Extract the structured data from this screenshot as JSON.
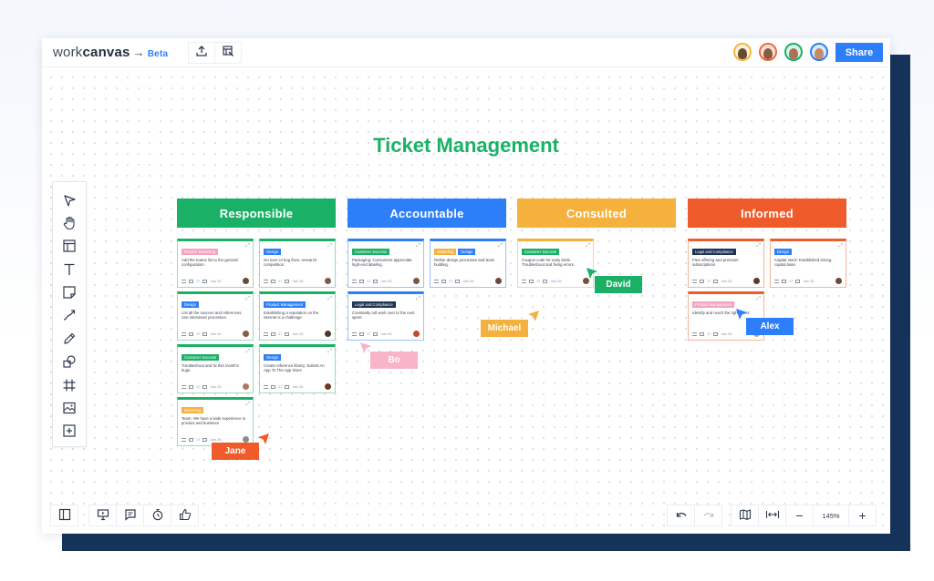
{
  "app": {
    "logo_light": "work",
    "logo_bold": "canvas",
    "logo_arrow": "→",
    "beta_label": "Beta",
    "share_label": "Share",
    "topbar_icons": [
      "upload-icon",
      "board-select-icon"
    ],
    "collaborators": [
      {
        "name": "collaborator-1",
        "ring": "#f5b83d",
        "skin": "#6b4a34"
      },
      {
        "name": "collaborator-2",
        "ring": "#ef6a3a",
        "skin": "#8a5a44"
      },
      {
        "name": "collaborator-3",
        "ring": "#1ab166",
        "skin": "#a87458"
      },
      {
        "name": "collaborator-4",
        "ring": "#2d7ff9",
        "skin": "#c48b68"
      }
    ]
  },
  "board": {
    "title": "Ticket Management",
    "columns": [
      {
        "label": "Responsible",
        "color": "#1ab166"
      },
      {
        "label": "Accountable",
        "color": "#2d7ff9"
      },
      {
        "label": "Consulted",
        "color": "#f5b13d"
      },
      {
        "label": "Informed",
        "color": "#ef5b2b"
      }
    ],
    "tag_colors": {
      "Product Marketing": "#f6a3bd",
      "Design": "#2d7ff9",
      "Product Management": "#2d7ff9",
      "Customer Success": "#1ab166",
      "Marketing": "#f5b13d",
      "Legal and Compliance": "#1f3354",
      "Product Management Pink": "#f6a3bd"
    },
    "cards": [
      {
        "col": 0,
        "tags": [
          {
            "text": "Product Marketing",
            "color": "#f6a3bd"
          }
        ],
        "desc": "Add the teams list to the general configuration.",
        "comments": "17",
        "date": "Jan 25"
      },
      {
        "col": 0,
        "tags": [
          {
            "text": "Design",
            "color": "#2d7ff9"
          }
        ],
        "desc": "Go over UI bug fixes, research competition.",
        "comments": "17",
        "date": "Jan 25"
      },
      {
        "col": 0,
        "tags": [
          {
            "text": "Design",
            "color": "#2d7ff9"
          }
        ],
        "desc": "List all the sources and references. Use interviews processes.",
        "comments": "17",
        "date": "Jan 25"
      },
      {
        "col": 0,
        "tags": [
          {
            "text": "Product Management",
            "color": "#2d7ff9"
          }
        ],
        "desc": "Establishing a reputation on the internet is a challenge",
        "comments": "17",
        "date": "Jan 25"
      },
      {
        "col": 0,
        "tags": [
          {
            "text": "Customer Success",
            "color": "#1ab166"
          }
        ],
        "desc": "Troubleshoot and fix this month's bugs.",
        "comments": "17",
        "date": "Jan 25"
      },
      {
        "col": 0,
        "tags": [
          {
            "text": "Design",
            "color": "#2d7ff9"
          }
        ],
        "desc": "Create reference library. Submit An App To The App Store",
        "comments": "17",
        "date": "Jan 25"
      },
      {
        "col": 0,
        "tags": [
          {
            "text": "Marketing",
            "color": "#f5b13d"
          }
        ],
        "desc": "Team: We have a wide experience in product and business",
        "comments": "17",
        "date": "Jan 25"
      },
      {
        "col": 1,
        "tags": [
          {
            "text": "Customer Success",
            "color": "#1ab166"
          }
        ],
        "desc": "Packaging: Consumers appreciate high-end labeling",
        "comments": "17",
        "date": "Jan 25"
      },
      {
        "col": 1,
        "tags": [
          {
            "text": "Marketing",
            "color": "#f5b13d"
          },
          {
            "text": "Design",
            "color": "#2d7ff9"
          }
        ],
        "desc": "Refine design processes and team building.",
        "comments": "17",
        "date": "Jan 25"
      },
      {
        "col": 1,
        "tags": [
          {
            "text": "Legal and Compliance",
            "color": "#1f3354"
          }
        ],
        "desc": "Constantly roll work over to the next sprint",
        "comments": "17",
        "date": "Jan 25"
      },
      {
        "col": 2,
        "tags": [
          {
            "text": "Customer Success",
            "color": "#1ab166"
          }
        ],
        "desc": "Coupon code for early birds. Troubleshoot and fixing errors.",
        "comments": "17",
        "date": "Jan 25"
      },
      {
        "col": 3,
        "tags": [
          {
            "text": "Legal and Compliance",
            "color": "#1f3354"
          }
        ],
        "desc": "Free offering and premium subscriptions",
        "comments": "17",
        "date": "Jan 25"
      },
      {
        "col": 3,
        "tags": [
          {
            "text": "Design",
            "color": "#2d7ff9"
          }
        ],
        "desc": "Capital stock: Established strong capital base.",
        "comments": "17",
        "date": "Jan 25"
      },
      {
        "col": 3,
        "tags": [
          {
            "text": "Product Management",
            "color": "#f6a3bd"
          }
        ],
        "desc": "Identify and reach the right talent",
        "comments": "17",
        "date": "Jan 25"
      }
    ],
    "cursors": [
      {
        "name": "David",
        "color": "#1ab166"
      },
      {
        "name": "Michael",
        "color": "#f5b13d"
      },
      {
        "name": "Bo",
        "color": "#f9b4c8"
      },
      {
        "name": "Alex",
        "color": "#2d7ff9"
      },
      {
        "name": "Jane",
        "color": "#ef5b2b"
      }
    ]
  },
  "toolbar": {
    "tools": [
      "select-pointer-icon",
      "hand-pan-icon",
      "template-icon",
      "text-icon",
      "sticky-note-icon",
      "connector-icon",
      "pen-icon",
      "shapes-icon",
      "frame-icon",
      "image-icon",
      "add-icon"
    ]
  },
  "bottom": {
    "zoom_level": "145%",
    "zoom_out": "−",
    "zoom_in": "+"
  }
}
